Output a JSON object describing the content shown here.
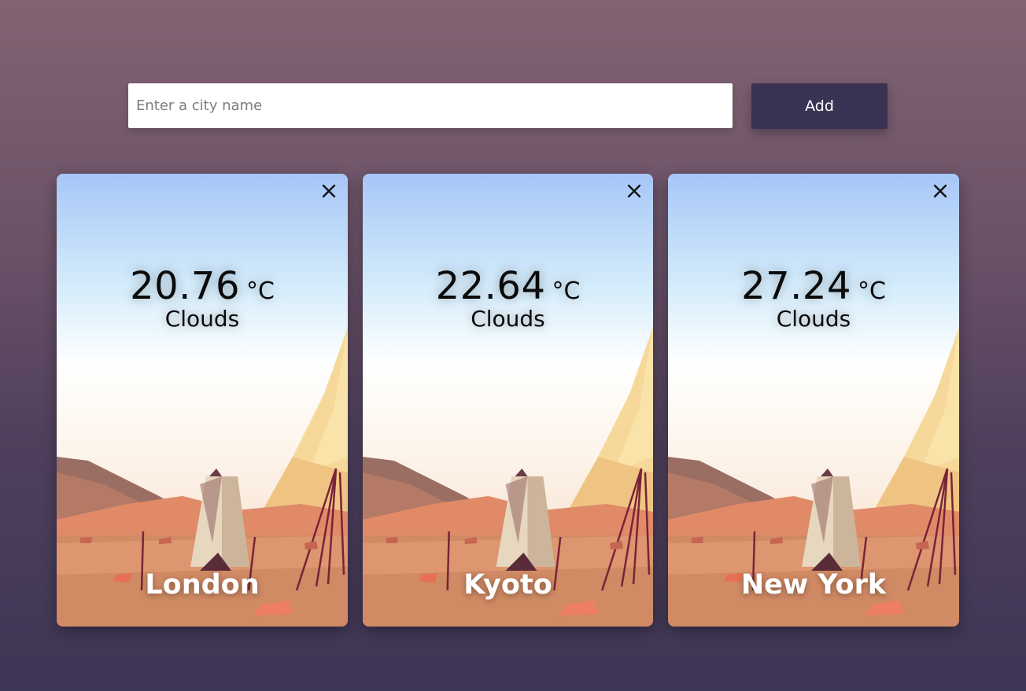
{
  "search": {
    "placeholder": "Enter a city name",
    "value": "",
    "add_label": "Add"
  },
  "cards": [
    {
      "city": "London",
      "temperature": "20.76",
      "unit": "°C",
      "condition": "Clouds",
      "close_icon": "close-icon"
    },
    {
      "city": "Kyoto",
      "temperature": "22.64",
      "unit": "°C",
      "condition": "Clouds",
      "close_icon": "close-icon"
    },
    {
      "city": "New York",
      "temperature": "27.24",
      "unit": "°C",
      "condition": "Clouds",
      "close_icon": "close-icon"
    }
  ],
  "colors": {
    "add_button": "#3a3353",
    "sky_top": "#a8c8f8",
    "sand": "#d08a64"
  }
}
